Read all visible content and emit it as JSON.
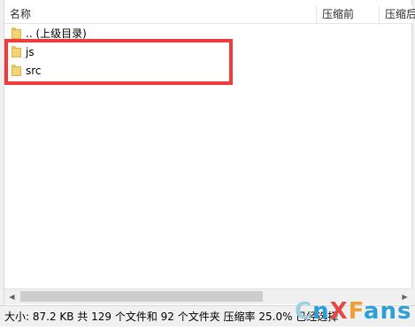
{
  "header": {
    "columns": [
      {
        "label": "名称"
      },
      {
        "label": "压缩前"
      },
      {
        "label": "压缩后"
      }
    ]
  },
  "file_list": {
    "items": [
      {
        "name": ".. (上级目录)",
        "icon": "folder-icon"
      },
      {
        "name": "js",
        "icon": "folder-icon"
      },
      {
        "name": "src",
        "icon": "folder-icon"
      }
    ]
  },
  "highlight": {
    "color": "#ee3b3b"
  },
  "status_bar": {
    "text": "大小: 87.2 KB 共 129 个文件和 92 个文件夹 压缩率 25.0% 已经选择"
  },
  "watermark": {
    "part1": "C",
    "part2": "n",
    "part3": "X",
    "part4": "F",
    "part5": "ans"
  }
}
